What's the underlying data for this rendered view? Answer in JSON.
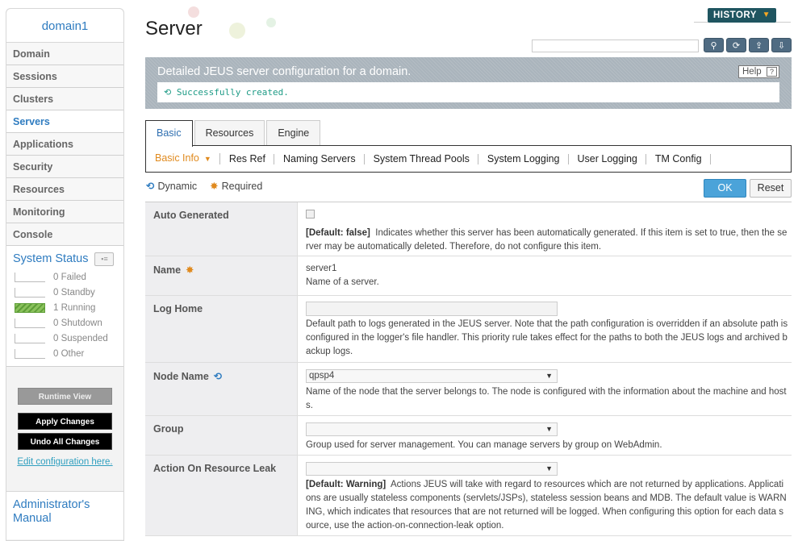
{
  "sidebar": {
    "domain": "domain1",
    "items": [
      {
        "label": "Domain"
      },
      {
        "label": "Sessions"
      },
      {
        "label": "Clusters"
      },
      {
        "label": "Servers"
      },
      {
        "label": "Applications"
      },
      {
        "label": "Security"
      },
      {
        "label": "Resources"
      },
      {
        "label": "Monitoring"
      },
      {
        "label": "Console"
      }
    ],
    "active_item": "Servers",
    "system_status": {
      "title": "System Status",
      "rows": [
        {
          "count": "0",
          "label": "Failed"
        },
        {
          "count": "0",
          "label": "Standby"
        },
        {
          "count": "1",
          "label": "Running"
        },
        {
          "count": "0",
          "label": "Shutdown"
        },
        {
          "count": "0",
          "label": "Suspended"
        },
        {
          "count": "0",
          "label": "Other"
        }
      ]
    },
    "runtime_view": "Runtime View",
    "apply_changes": "Apply Changes",
    "undo_changes": "Undo All Changes",
    "edit_config": "Edit configuration here.",
    "admin_manual": "Administrator's Manual"
  },
  "header": {
    "title": "Server",
    "history": "HISTORY"
  },
  "banner": {
    "title": "Detailed JEUS server configuration for a domain.",
    "help": "Help",
    "message": "Successfully created."
  },
  "tabs": [
    {
      "label": "Basic"
    },
    {
      "label": "Resources"
    },
    {
      "label": "Engine"
    }
  ],
  "subtabs": [
    {
      "label": "Basic Info"
    },
    {
      "label": "Res Ref"
    },
    {
      "label": "Naming Servers"
    },
    {
      "label": "System Thread Pools"
    },
    {
      "label": "System Logging"
    },
    {
      "label": "User Logging"
    },
    {
      "label": "TM Config"
    }
  ],
  "legend": {
    "dynamic": "Dynamic",
    "required": "Required"
  },
  "buttons": {
    "ok": "OK",
    "reset": "Reset"
  },
  "form": {
    "auto_generated": {
      "label": "Auto Generated",
      "default": "[Default: false]",
      "desc": "Indicates whether this server has been automatically generated. If this item is set to true, then the server may be automatically deleted. Therefore, do not configure this item."
    },
    "name": {
      "label": "Name",
      "value": "server1",
      "desc": "Name of a server."
    },
    "log_home": {
      "label": "Log Home",
      "value": "",
      "desc": "Default path to logs generated in the JEUS server. Note that the path configuration is overridden if an absolute path is configured in the logger's file handler. This priority rule takes effect for the paths to both the JEUS logs and archived backup logs."
    },
    "node_name": {
      "label": "Node Name",
      "value": "qpsp4",
      "desc": "Name of the node that the server belongs to. The node is configured with the information about the machine and hosts."
    },
    "group": {
      "label": "Group",
      "value": "",
      "desc": "Group used for server management. You can manage servers by group on WebAdmin."
    },
    "resource_leak": {
      "label": "Action On Resource Leak",
      "value": "",
      "default": "[Default: Warning]",
      "desc": "Actions JEUS will take with regard to resources which are not returned by applications. Applications are usually stateless components (servlets/JSPs), stateless session beans and MDB. The default value is WARNING, which indicates that resources that are not returned will be logged. When configuring this option for each data source, use the action-on-connection-leak option."
    }
  }
}
